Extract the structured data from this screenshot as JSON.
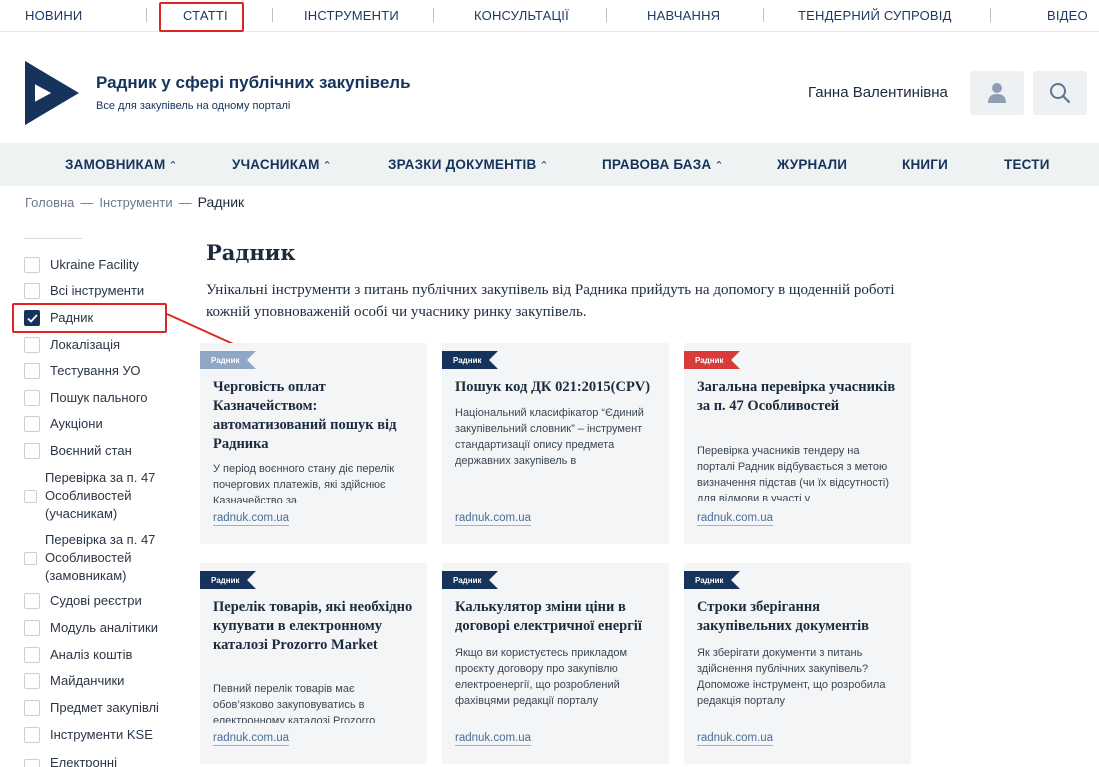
{
  "top_nav": [
    {
      "label": "НОВИНИ"
    },
    {
      "label": "СТАТТІ"
    },
    {
      "label": "ІНСТРУМЕНТИ"
    },
    {
      "label": "КОНСУЛЬТАЦІЇ"
    },
    {
      "label": "НАВЧАННЯ"
    },
    {
      "label": "ТЕНДЕРНИЙ СУПРОВІД"
    },
    {
      "label": "ВІДЕО"
    }
  ],
  "header": {
    "title": "Радник у сфері публічних закупівель",
    "subtitle": "Все для закупівель на одному порталі",
    "user_name": "Ганна Валентинівна",
    "brand_color": "#15335b"
  },
  "main_nav": [
    {
      "label": "ЗАМОВНИКАМ",
      "caret": "⌃"
    },
    {
      "label": "УЧАСНИКАМ",
      "caret": "⌃"
    },
    {
      "label": "ЗРАЗКИ ДОКУМЕНТІВ",
      "caret": "⌃"
    },
    {
      "label": "ПРАВОВА БАЗА",
      "caret": "⌃"
    },
    {
      "label": "ЖУРНАЛИ"
    },
    {
      "label": "КНИГИ"
    },
    {
      "label": "ТЕСТИ"
    }
  ],
  "breadcrumb": {
    "home": "Головна",
    "section": "Інструменти",
    "current": "Радник",
    "separator": "—"
  },
  "sidebar": {
    "items": [
      {
        "label": "Ukraine Facility",
        "checked": false
      },
      {
        "label": "Всі інструменти",
        "checked": false
      },
      {
        "label": "Радник",
        "checked": true
      },
      {
        "label": "Локалізація",
        "checked": false
      },
      {
        "label": "Тестування УО",
        "checked": false
      },
      {
        "label": "Пошук пального",
        "checked": false
      },
      {
        "label": "Аукціони",
        "checked": false
      },
      {
        "label": "Воєнний стан",
        "checked": false
      },
      {
        "label": "Перевірка за п. 47 Особливостей (учасникам)",
        "checked": false
      },
      {
        "label": "Перевірка за п. 47 Особливостей (замовникам)",
        "checked": false
      },
      {
        "label": "Судові реєстри",
        "checked": false
      },
      {
        "label": "Модуль аналітики",
        "checked": false
      },
      {
        "label": "Аналіз коштів",
        "checked": false
      },
      {
        "label": "Майданчики",
        "checked": false
      },
      {
        "label": "Предмет закупівлі",
        "checked": false
      },
      {
        "label": "Інструменти KSE",
        "checked": false
      },
      {
        "label": "Електронні",
        "checked": false
      }
    ]
  },
  "content": {
    "title": "Радник",
    "description": "Унікальні інструменти з питань публічних закупівель від Радника прийдуть на допомогу в щоденній роботі кожній уповноваженій особі чи учаснику ринку закупівель."
  },
  "cards": [
    {
      "tag": "Радник",
      "tag_color": "#8fa6c4",
      "title": "Черговість оплат Казначейством: автоматизований пошук від Радника",
      "text": "У період воєнного стану діє перелік почергових платежів, які здійснює Казначейство за",
      "link": "radnuk.com.ua"
    },
    {
      "tag": "Радник",
      "tag_color": "#15335b",
      "title": "Пошук код ДК 021:2015(CPV)",
      "text": "Національний класифікатор “Єдиний закупівельний словник” – інструмент стандартизації опису предмета державних закупівель в",
      "link": "radnuk.com.ua"
    },
    {
      "tag": "Радник",
      "tag_color": "#d93a3a",
      "title": "Загальна перевірка учасників за п. 47 Особливостей",
      "text": "Перевірка учасників тендеру на порталі Радник відбувається з метою визначення підстав (чи їх відсутності) для відмови в участі у",
      "link": "radnuk.com.ua"
    },
    {
      "tag": "Радник",
      "tag_color": "#15335b",
      "title": "Перелік товарів, які необхідно купувати в електронному каталозі Prozorro Market",
      "text": "Певний перелік товарів має обов’язково закуповуватись в електронному каталозі Prozorro",
      "link": "radnuk.com.ua"
    },
    {
      "tag": "Радник",
      "tag_color": "#15335b",
      "title": "Калькулятор зміни ціни в договорі електричної енергії",
      "text": "Якщо ви користуєтесь прикладом проєкту договору про закупівлю електроенергії, що розроблений фахівцями редакції порталу",
      "link": "radnuk.com.ua"
    },
    {
      "tag": "Радник",
      "tag_color": "#15335b",
      "title": "Строки зберігання закупівельних документів",
      "text": "Як зберігати документи з питань здійснення публічних закупівель? Допоможе інструмент, що розробила редакція порталу",
      "link": "radnuk.com.ua"
    }
  ]
}
